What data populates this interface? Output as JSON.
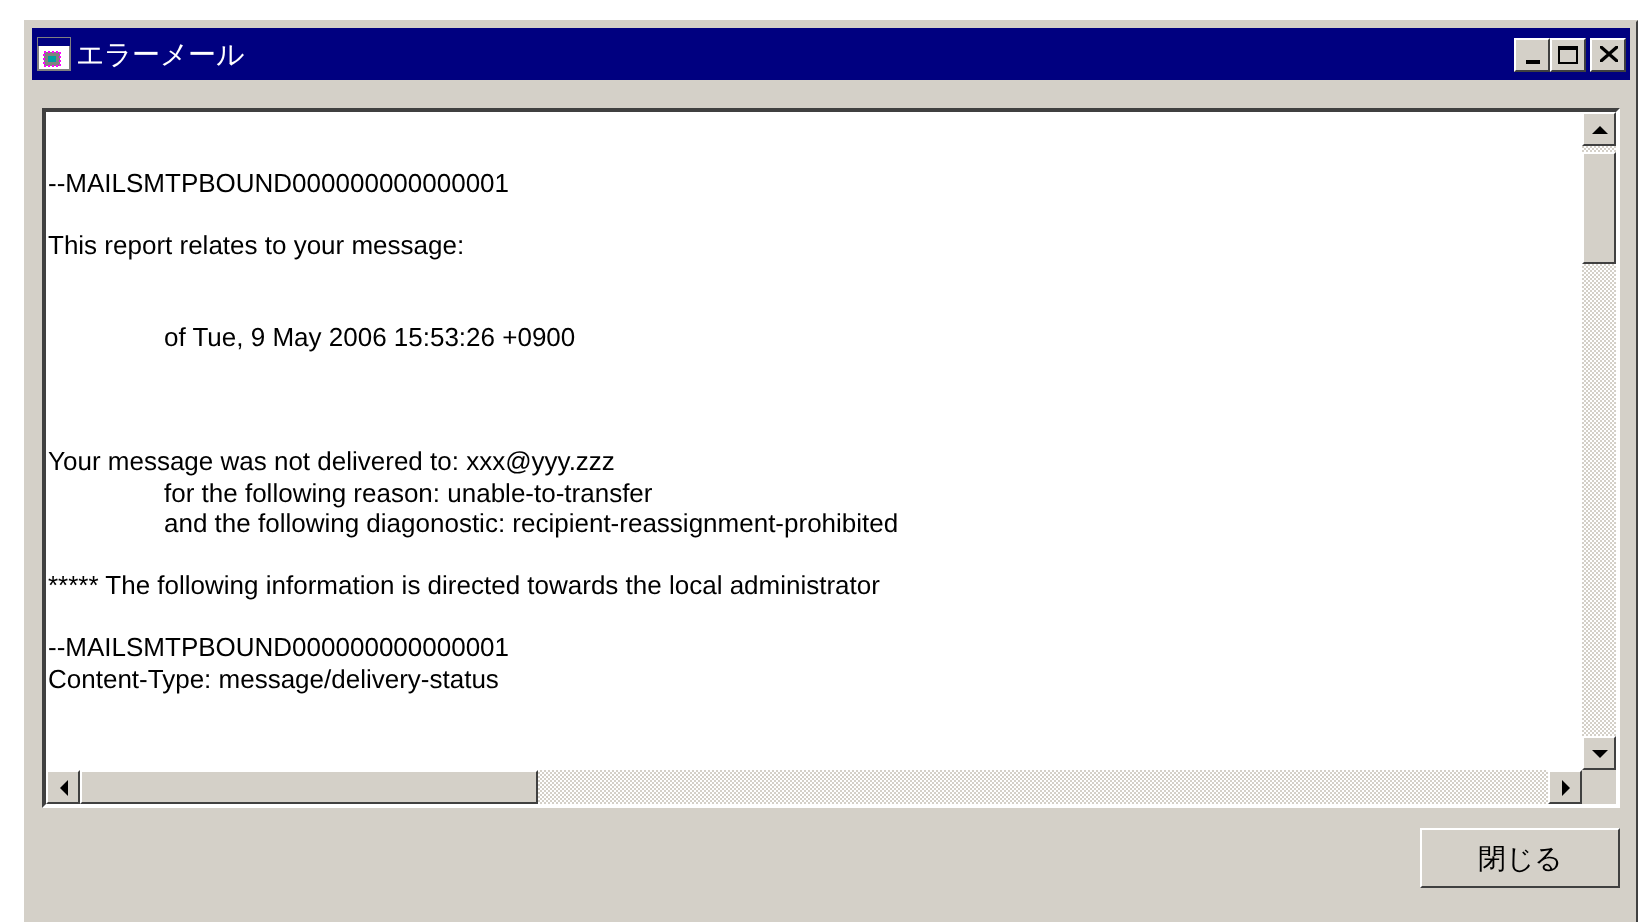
{
  "window": {
    "title": "エラーメール"
  },
  "message_lines": [
    {
      "kind": "blank"
    },
    {
      "kind": "text",
      "text": "--MAILSMTPBOUND000000000000001",
      "indented": false
    },
    {
      "kind": "blank"
    },
    {
      "kind": "text",
      "text": "This report relates to your message:",
      "indented": false
    },
    {
      "kind": "blank"
    },
    {
      "kind": "blank"
    },
    {
      "kind": "text",
      "text": "of Tue, 9 May 2006 15:53:26 +0900",
      "indented": true
    },
    {
      "kind": "blank"
    },
    {
      "kind": "blank"
    },
    {
      "kind": "blank"
    },
    {
      "kind": "text",
      "text": "Your message was not delivered to: xxx@yyy.zzz",
      "indented": false
    },
    {
      "kind": "text",
      "text": "for the following reason: unable-to-transfer",
      "indented": true
    },
    {
      "kind": "text",
      "text": "and the following diagonostic: recipient-reassignment-prohibited",
      "indented": true
    },
    {
      "kind": "blank"
    },
    {
      "kind": "text",
      "text": "***** The following information is directed towards the local administrator",
      "indented": false
    },
    {
      "kind": "blank"
    },
    {
      "kind": "text",
      "text": "--MAILSMTPBOUND000000000000001",
      "indented": false
    },
    {
      "kind": "text",
      "text": "Content-Type: message/delivery-status",
      "indented": false
    }
  ],
  "buttons": [
    {
      "label": "閉じる"
    }
  ]
}
